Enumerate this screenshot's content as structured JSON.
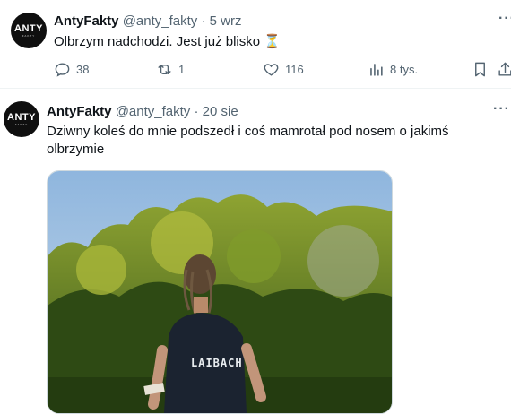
{
  "tweet1": {
    "author_name": "AntyFakty",
    "handle": "@anty_fakty",
    "separator": "·",
    "date": "5 wrz",
    "text": "Olbrzym nadchodzi. Jest już blisko",
    "emoji": "⏳",
    "replies": "38",
    "retweets": "1",
    "likes": "116",
    "views": "8 tys."
  },
  "tweet2": {
    "author_name": "AntyFakty",
    "handle": "@anty_fakty",
    "separator": "·",
    "date": "20 sie",
    "text_line1": "Dziwny koleś do mnie podszedł i coś mamrotał pod nosem o jakimś",
    "text_line2": "olbrzymie",
    "shirt_text": "LAIBACH"
  },
  "avatar": {
    "logo": "ANTY",
    "sub": "FAKTY"
  },
  "more_label": "···",
  "colors": {
    "muted": "#536471",
    "text": "#0f1419",
    "divider": "#eff3f4"
  }
}
